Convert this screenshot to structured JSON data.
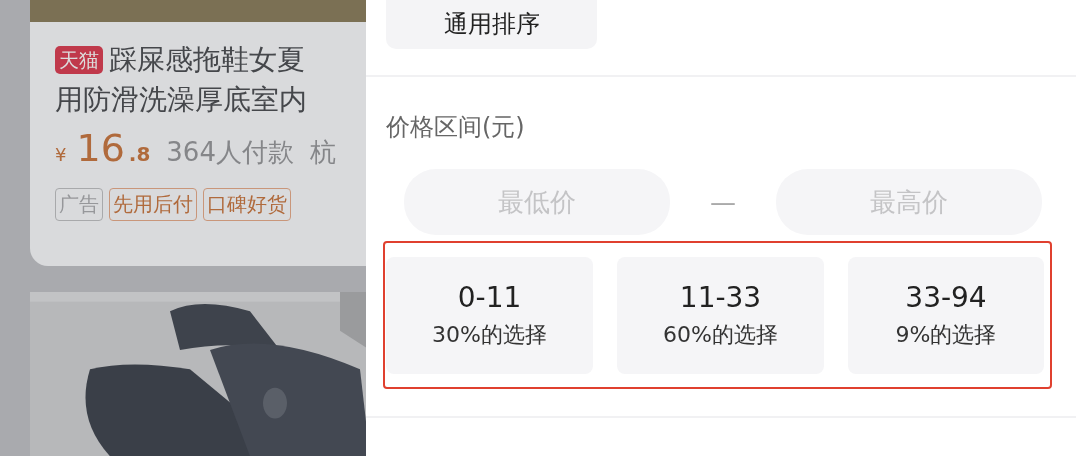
{
  "product_card": {
    "store_badge": "天猫",
    "title_lines": [
      "踩屎感拖鞋女夏",
      "用防滑洗澡厚底室内"
    ],
    "currency": "¥",
    "price_integer": "16",
    "price_decimal": ".8",
    "sales": "364人付款",
    "location": "杭",
    "tags": [
      {
        "label": "广告",
        "kind": "plain"
      },
      {
        "label": "先用后付",
        "kind": "promo"
      },
      {
        "label": "口碑好货",
        "kind": "promo"
      }
    ]
  },
  "filter_panel": {
    "sort_option": "通用排序",
    "price_section": {
      "title": "价格区间(元)",
      "min_placeholder": "最低价",
      "separator": "—",
      "max_placeholder": "最高价",
      "ranges": [
        {
          "range": "0-11",
          "share": "30%的选择"
        },
        {
          "range": "11-33",
          "share": "60%的选择"
        },
        {
          "range": "33-94",
          "share": "9%的选择"
        }
      ]
    }
  }
}
